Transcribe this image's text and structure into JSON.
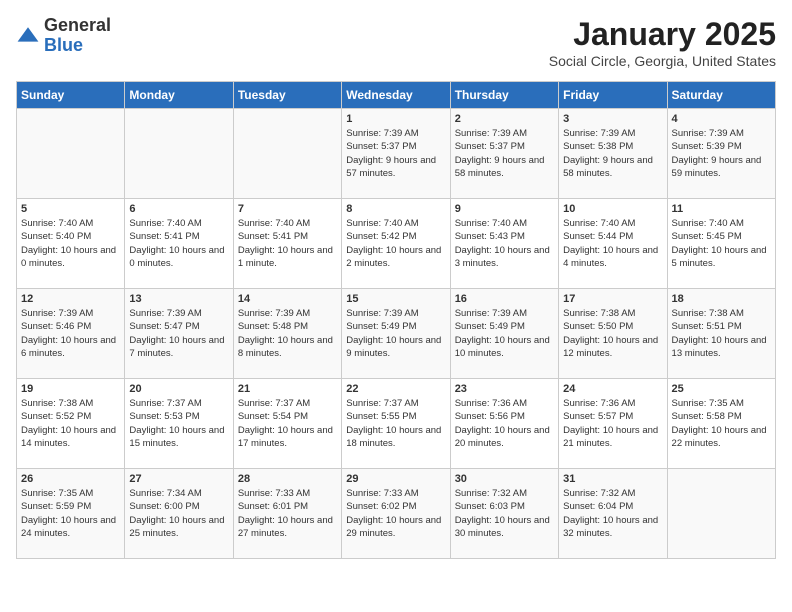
{
  "header": {
    "logo": {
      "general": "General",
      "blue": "Blue"
    },
    "title": "January 2025",
    "subtitle": "Social Circle, Georgia, United States"
  },
  "days_of_week": [
    "Sunday",
    "Monday",
    "Tuesday",
    "Wednesday",
    "Thursday",
    "Friday",
    "Saturday"
  ],
  "weeks": [
    [
      {
        "day": "",
        "sunrise": "",
        "sunset": "",
        "daylight": ""
      },
      {
        "day": "",
        "sunrise": "",
        "sunset": "",
        "daylight": ""
      },
      {
        "day": "",
        "sunrise": "",
        "sunset": "",
        "daylight": ""
      },
      {
        "day": "1",
        "sunrise": "Sunrise: 7:39 AM",
        "sunset": "Sunset: 5:37 PM",
        "daylight": "Daylight: 9 hours and 57 minutes."
      },
      {
        "day": "2",
        "sunrise": "Sunrise: 7:39 AM",
        "sunset": "Sunset: 5:37 PM",
        "daylight": "Daylight: 9 hours and 58 minutes."
      },
      {
        "day": "3",
        "sunrise": "Sunrise: 7:39 AM",
        "sunset": "Sunset: 5:38 PM",
        "daylight": "Daylight: 9 hours and 58 minutes."
      },
      {
        "day": "4",
        "sunrise": "Sunrise: 7:39 AM",
        "sunset": "Sunset: 5:39 PM",
        "daylight": "Daylight: 9 hours and 59 minutes."
      }
    ],
    [
      {
        "day": "5",
        "sunrise": "Sunrise: 7:40 AM",
        "sunset": "Sunset: 5:40 PM",
        "daylight": "Daylight: 10 hours and 0 minutes."
      },
      {
        "day": "6",
        "sunrise": "Sunrise: 7:40 AM",
        "sunset": "Sunset: 5:41 PM",
        "daylight": "Daylight: 10 hours and 0 minutes."
      },
      {
        "day": "7",
        "sunrise": "Sunrise: 7:40 AM",
        "sunset": "Sunset: 5:41 PM",
        "daylight": "Daylight: 10 hours and 1 minute."
      },
      {
        "day": "8",
        "sunrise": "Sunrise: 7:40 AM",
        "sunset": "Sunset: 5:42 PM",
        "daylight": "Daylight: 10 hours and 2 minutes."
      },
      {
        "day": "9",
        "sunrise": "Sunrise: 7:40 AM",
        "sunset": "Sunset: 5:43 PM",
        "daylight": "Daylight: 10 hours and 3 minutes."
      },
      {
        "day": "10",
        "sunrise": "Sunrise: 7:40 AM",
        "sunset": "Sunset: 5:44 PM",
        "daylight": "Daylight: 10 hours and 4 minutes."
      },
      {
        "day": "11",
        "sunrise": "Sunrise: 7:40 AM",
        "sunset": "Sunset: 5:45 PM",
        "daylight": "Daylight: 10 hours and 5 minutes."
      }
    ],
    [
      {
        "day": "12",
        "sunrise": "Sunrise: 7:39 AM",
        "sunset": "Sunset: 5:46 PM",
        "daylight": "Daylight: 10 hours and 6 minutes."
      },
      {
        "day": "13",
        "sunrise": "Sunrise: 7:39 AM",
        "sunset": "Sunset: 5:47 PM",
        "daylight": "Daylight: 10 hours and 7 minutes."
      },
      {
        "day": "14",
        "sunrise": "Sunrise: 7:39 AM",
        "sunset": "Sunset: 5:48 PM",
        "daylight": "Daylight: 10 hours and 8 minutes."
      },
      {
        "day": "15",
        "sunrise": "Sunrise: 7:39 AM",
        "sunset": "Sunset: 5:49 PM",
        "daylight": "Daylight: 10 hours and 9 minutes."
      },
      {
        "day": "16",
        "sunrise": "Sunrise: 7:39 AM",
        "sunset": "Sunset: 5:49 PM",
        "daylight": "Daylight: 10 hours and 10 minutes."
      },
      {
        "day": "17",
        "sunrise": "Sunrise: 7:38 AM",
        "sunset": "Sunset: 5:50 PM",
        "daylight": "Daylight: 10 hours and 12 minutes."
      },
      {
        "day": "18",
        "sunrise": "Sunrise: 7:38 AM",
        "sunset": "Sunset: 5:51 PM",
        "daylight": "Daylight: 10 hours and 13 minutes."
      }
    ],
    [
      {
        "day": "19",
        "sunrise": "Sunrise: 7:38 AM",
        "sunset": "Sunset: 5:52 PM",
        "daylight": "Daylight: 10 hours and 14 minutes."
      },
      {
        "day": "20",
        "sunrise": "Sunrise: 7:37 AM",
        "sunset": "Sunset: 5:53 PM",
        "daylight": "Daylight: 10 hours and 15 minutes."
      },
      {
        "day": "21",
        "sunrise": "Sunrise: 7:37 AM",
        "sunset": "Sunset: 5:54 PM",
        "daylight": "Daylight: 10 hours and 17 minutes."
      },
      {
        "day": "22",
        "sunrise": "Sunrise: 7:37 AM",
        "sunset": "Sunset: 5:55 PM",
        "daylight": "Daylight: 10 hours and 18 minutes."
      },
      {
        "day": "23",
        "sunrise": "Sunrise: 7:36 AM",
        "sunset": "Sunset: 5:56 PM",
        "daylight": "Daylight: 10 hours and 20 minutes."
      },
      {
        "day": "24",
        "sunrise": "Sunrise: 7:36 AM",
        "sunset": "Sunset: 5:57 PM",
        "daylight": "Daylight: 10 hours and 21 minutes."
      },
      {
        "day": "25",
        "sunrise": "Sunrise: 7:35 AM",
        "sunset": "Sunset: 5:58 PM",
        "daylight": "Daylight: 10 hours and 22 minutes."
      }
    ],
    [
      {
        "day": "26",
        "sunrise": "Sunrise: 7:35 AM",
        "sunset": "Sunset: 5:59 PM",
        "daylight": "Daylight: 10 hours and 24 minutes."
      },
      {
        "day": "27",
        "sunrise": "Sunrise: 7:34 AM",
        "sunset": "Sunset: 6:00 PM",
        "daylight": "Daylight: 10 hours and 25 minutes."
      },
      {
        "day": "28",
        "sunrise": "Sunrise: 7:33 AM",
        "sunset": "Sunset: 6:01 PM",
        "daylight": "Daylight: 10 hours and 27 minutes."
      },
      {
        "day": "29",
        "sunrise": "Sunrise: 7:33 AM",
        "sunset": "Sunset: 6:02 PM",
        "daylight": "Daylight: 10 hours and 29 minutes."
      },
      {
        "day": "30",
        "sunrise": "Sunrise: 7:32 AM",
        "sunset": "Sunset: 6:03 PM",
        "daylight": "Daylight: 10 hours and 30 minutes."
      },
      {
        "day": "31",
        "sunrise": "Sunrise: 7:32 AM",
        "sunset": "Sunset: 6:04 PM",
        "daylight": "Daylight: 10 hours and 32 minutes."
      },
      {
        "day": "",
        "sunrise": "",
        "sunset": "",
        "daylight": ""
      }
    ]
  ]
}
